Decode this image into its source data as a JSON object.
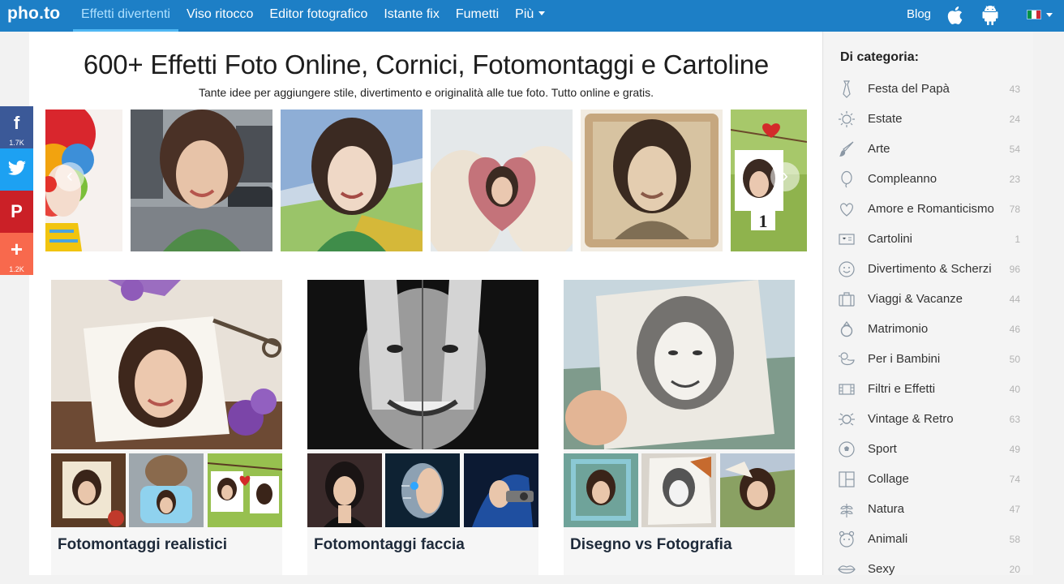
{
  "brand": {
    "logo": "pho.to"
  },
  "nav": [
    {
      "label": "Effetti divertenti",
      "active": true
    },
    {
      "label": "Viso ritocco"
    },
    {
      "label": "Editor fotografico"
    },
    {
      "label": "Istante fix"
    },
    {
      "label": "Fumetti"
    },
    {
      "label": "Più"
    }
  ],
  "top_right": {
    "blog": "Blog",
    "icons": [
      "apple-icon",
      "android-icon",
      "italian-flag-icon"
    ]
  },
  "colors": {
    "topbar": "#1d7fc6",
    "facebook": "#3b5998",
    "twitter": "#1da1f2",
    "pinterest": "#cb2027",
    "addthis": "#f8694d"
  },
  "page": {
    "headline": "600+ Effetti Foto Online, Cornici, Fotomontaggi e Cartoline",
    "subhead": "Tante idee per aggiungere stile, divertimento e originalità alle tue foto. Tutto online e gratis."
  },
  "social": [
    {
      "name": "facebook",
      "glyph": "f",
      "count": "1.7K"
    },
    {
      "name": "twitter",
      "glyph": "",
      "count": ""
    },
    {
      "name": "pinterest",
      "glyph": "P",
      "count": ""
    },
    {
      "name": "addthis",
      "glyph": "+",
      "count": "1.2K"
    }
  ],
  "carousel": {
    "slides": [
      "clown",
      "street-portrait",
      "pencil-sketch",
      "heart-in-hands",
      "vintage-photo",
      "hanging-photo"
    ],
    "slide_label": "1"
  },
  "cards": [
    {
      "title": "Fotomontaggi realistici"
    },
    {
      "title": "Fotomontaggi faccia"
    },
    {
      "title": "Disegno vs Fotografia"
    }
  ],
  "sidebar": {
    "title": "Di categoria:",
    "items": [
      {
        "label": "Festa del Papà",
        "count": "43",
        "icon": "tie-icon"
      },
      {
        "label": "Estate",
        "count": "24",
        "icon": "sun-icon"
      },
      {
        "label": "Arte",
        "count": "54",
        "icon": "brush-icon"
      },
      {
        "label": "Compleanno",
        "count": "23",
        "icon": "balloon-icon"
      },
      {
        "label": "Amore e Romanticismo",
        "count": "78",
        "icon": "heart-icon"
      },
      {
        "label": "Cartolini",
        "count": "1",
        "icon": "postcard-icon"
      },
      {
        "label": "Divertimento & Scherzi",
        "count": "96",
        "icon": "smiley-icon"
      },
      {
        "label": "Viaggi & Vacanze",
        "count": "44",
        "icon": "suitcase-icon"
      },
      {
        "label": "Matrimonio",
        "count": "46",
        "icon": "ring-icon"
      },
      {
        "label": "Per i Bambini",
        "count": "50",
        "icon": "duck-icon"
      },
      {
        "label": "Filtri e Effetti",
        "count": "40",
        "icon": "film-icon"
      },
      {
        "label": "Vintage & Retro",
        "count": "63",
        "icon": "vintage-icon"
      },
      {
        "label": "Sport",
        "count": "49",
        "icon": "soccer-ball-icon"
      },
      {
        "label": "Collage",
        "count": "74",
        "icon": "collage-icon"
      },
      {
        "label": "Natura",
        "count": "47",
        "icon": "plant-icon"
      },
      {
        "label": "Animali",
        "count": "58",
        "icon": "animal-icon"
      },
      {
        "label": "Sexy",
        "count": "20",
        "icon": "lips-icon"
      }
    ]
  }
}
